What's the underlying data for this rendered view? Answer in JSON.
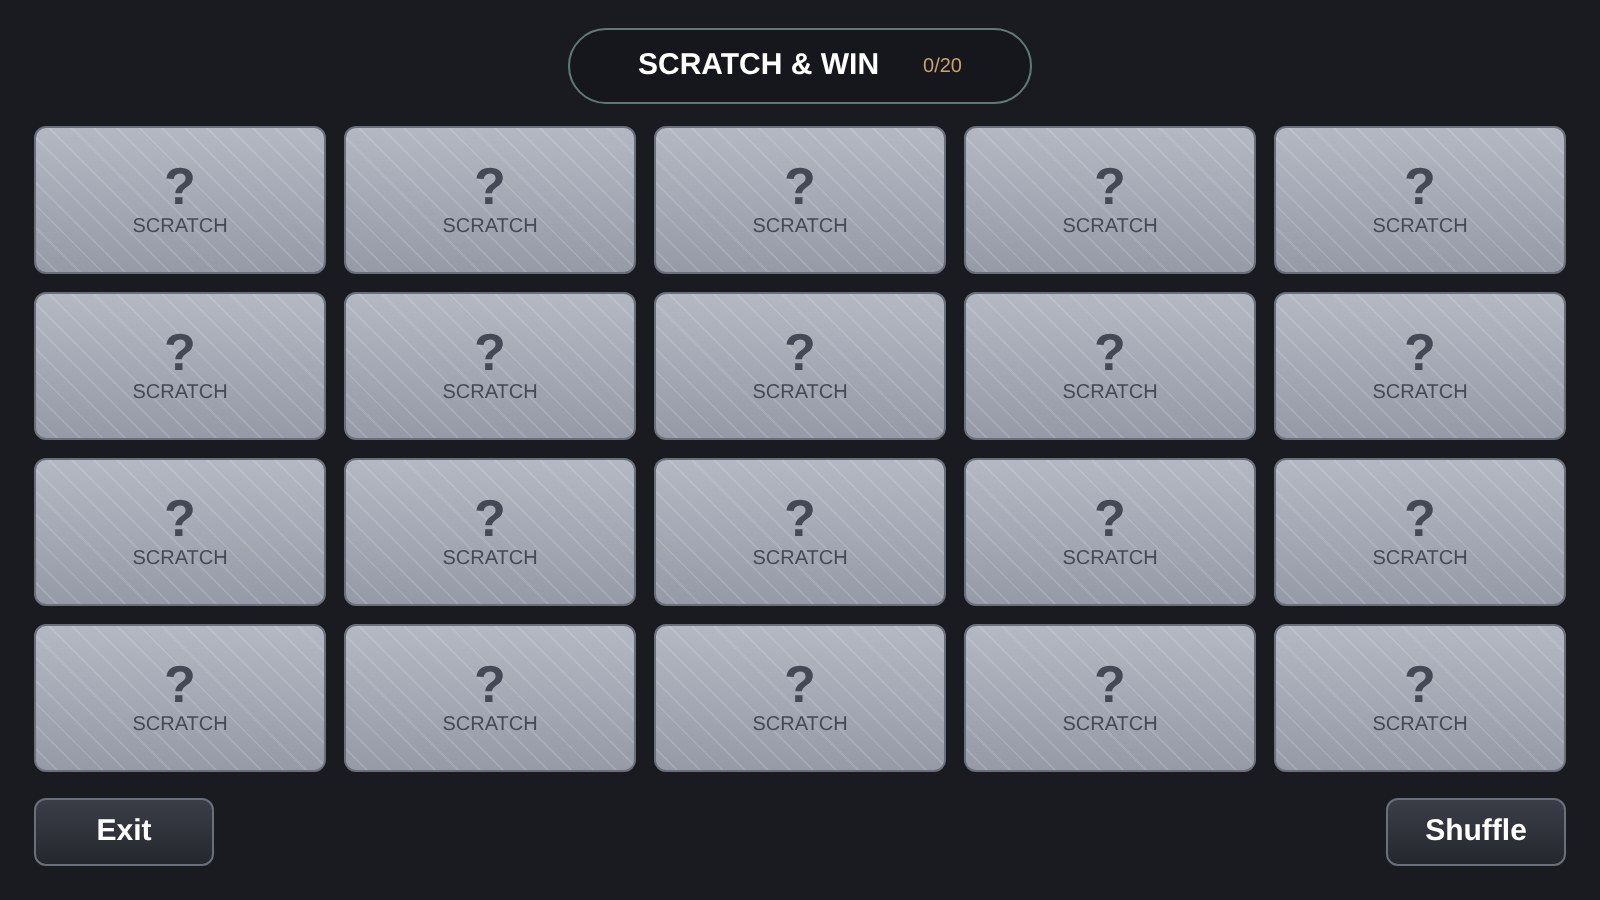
{
  "header": {
    "title": "SCRATCH & WIN",
    "counter": "0/20"
  },
  "cards": [
    {
      "symbol": "?",
      "label": "SCRATCH"
    },
    {
      "symbol": "?",
      "label": "SCRATCH"
    },
    {
      "symbol": "?",
      "label": "SCRATCH"
    },
    {
      "symbol": "?",
      "label": "SCRATCH"
    },
    {
      "symbol": "?",
      "label": "SCRATCH"
    },
    {
      "symbol": "?",
      "label": "SCRATCH"
    },
    {
      "symbol": "?",
      "label": "SCRATCH"
    },
    {
      "symbol": "?",
      "label": "SCRATCH"
    },
    {
      "symbol": "?",
      "label": "SCRATCH"
    },
    {
      "symbol": "?",
      "label": "SCRATCH"
    },
    {
      "symbol": "?",
      "label": "SCRATCH"
    },
    {
      "symbol": "?",
      "label": "SCRATCH"
    },
    {
      "symbol": "?",
      "label": "SCRATCH"
    },
    {
      "symbol": "?",
      "label": "SCRATCH"
    },
    {
      "symbol": "?",
      "label": "SCRATCH"
    },
    {
      "symbol": "?",
      "label": "SCRATCH"
    },
    {
      "symbol": "?",
      "label": "SCRATCH"
    },
    {
      "symbol": "?",
      "label": "SCRATCH"
    },
    {
      "symbol": "?",
      "label": "SCRATCH"
    },
    {
      "symbol": "?",
      "label": "SCRATCH"
    }
  ],
  "buttons": [
    {
      "label": "Exit"
    },
    {
      "label": "Shuffle"
    }
  ]
}
